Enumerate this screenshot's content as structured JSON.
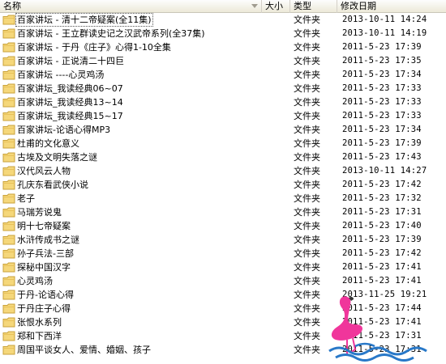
{
  "columns": {
    "name": "名称",
    "size": "大小",
    "type": "类型",
    "date": "修改日期"
  },
  "rows": [
    {
      "name": "百家讲坛 - 清十二帝疑案(全11集)",
      "type": "文件夹",
      "date": "2013-10-11 14:24"
    },
    {
      "name": "百家讲坛 - 王立群读史记之汉武帝系列(全37集)",
      "type": "文件夹",
      "date": "2013-10-11 14:19"
    },
    {
      "name": "百家讲坛 - 于丹《庄子》心得1-10全集",
      "type": "文件夹",
      "date": "2011-5-23 17:39"
    },
    {
      "name": "百家讲坛 - 正说清二十四巨",
      "type": "文件夹",
      "date": "2011-5-23 17:35"
    },
    {
      "name": "百家讲坛 ----心灵鸡汤",
      "type": "文件夹",
      "date": "2011-5-23 17:34"
    },
    {
      "name": "百家讲坛_我读经典06~07",
      "type": "文件夹",
      "date": "2011-5-23 17:33"
    },
    {
      "name": "百家讲坛_我读经典13~14",
      "type": "文件夹",
      "date": "2011-5-23 17:33"
    },
    {
      "name": "百家讲坛_我读经典15~17",
      "type": "文件夹",
      "date": "2011-5-23 17:33"
    },
    {
      "name": "百家讲坛-论语心得MP3",
      "type": "文件夹",
      "date": "2011-5-23 17:34"
    },
    {
      "name": "杜甫的文化意义",
      "type": "文件夹",
      "date": "2011-5-23 17:39"
    },
    {
      "name": "古埃及文明失落之谜",
      "type": "文件夹",
      "date": "2011-5-23 17:43"
    },
    {
      "name": "汉代风云人物",
      "type": "文件夹",
      "date": "2013-10-11 14:27"
    },
    {
      "name": "孔庆东看武侠小说",
      "type": "文件夹",
      "date": "2011-5-23 17:42"
    },
    {
      "name": "老子",
      "type": "文件夹",
      "date": "2011-5-23 17:32"
    },
    {
      "name": "马瑞芳说鬼",
      "type": "文件夹",
      "date": "2011-5-23 17:31"
    },
    {
      "name": "明十七帝疑案",
      "type": "文件夹",
      "date": "2011-5-23 17:40"
    },
    {
      "name": "水浒传成书之谜",
      "type": "文件夹",
      "date": "2011-5-23 17:39"
    },
    {
      "name": "孙子兵法-三部",
      "type": "文件夹",
      "date": "2011-5-23 17:42"
    },
    {
      "name": "探秘中国汉字",
      "type": "文件夹",
      "date": "2011-5-23 17:41"
    },
    {
      "name": "心灵鸡汤",
      "type": "文件夹",
      "date": "2011-5-23 17:41"
    },
    {
      "name": "于丹-论语心得",
      "type": "文件夹",
      "date": "2013-11-25 19:21"
    },
    {
      "name": "于丹庄子心得",
      "type": "文件夹",
      "date": "2011-5-23 17:44"
    },
    {
      "name": "张恨水系列",
      "type": "文件夹",
      "date": "2011-5-23 17:41"
    },
    {
      "name": "郑和下西洋",
      "type": "文件夹",
      "date": "2011-5-23 17:31"
    },
    {
      "name": "周国平谈女人、爱情、婚姻、孩子",
      "type": "文件夹",
      "date": "2011-5-23 17:31"
    }
  ],
  "icons": {
    "folder": "folder-icon",
    "watermark": "flamingo-logo"
  },
  "colors": {
    "folder_fill": "#f5d77a",
    "folder_edge": "#c9a23a",
    "flamingo": "#f0369b",
    "water": "#2878c8"
  }
}
